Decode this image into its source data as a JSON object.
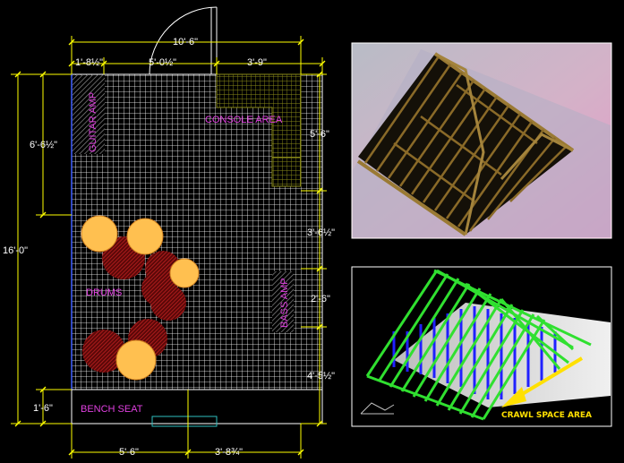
{
  "plan": {
    "labels": {
      "guitar_amp": "GUITAR AMP",
      "console_area": "CONSOLE AREA",
      "drums": "DRUMS",
      "bass_amp": "BASS AMP",
      "bench_seat": "BENCH SEAT"
    },
    "dimensions": {
      "top_total": "10'-6\"",
      "top_left": "1'-8½\"",
      "top_mid": "5'-0½\"",
      "top_right": "3'-9\"",
      "left_total": "16'-0\"",
      "left_upper": "6'-6½\"",
      "left_lower": "1'-6\"",
      "right_1": "5'-6\"",
      "right_2": "3'-6½\"",
      "right_3": "2'-6\"",
      "right_4": "4'-5½\"",
      "bottom_left": "5'-6\"",
      "bottom_right": "3'-8¾\""
    },
    "colors": {
      "grid": "#ffffff",
      "console": "#7c7c14",
      "drum_red": "#a01818",
      "drum_orange": "#ffc050",
      "dimension": "#ffff00",
      "label": "#e040e0"
    }
  },
  "truss_render": {
    "colors": {
      "sky_top": "#c2c2c6",
      "sky_bottom": "#d9a8c8",
      "wood": "#8a6a28"
    }
  },
  "wireframe": {
    "crawl_label": "CRAWL SPACE AREA",
    "colors": {
      "rafter": "#30e030",
      "stud": "#2020ff",
      "floor": "#d8d8d8",
      "arrow": "#ffe000"
    }
  }
}
